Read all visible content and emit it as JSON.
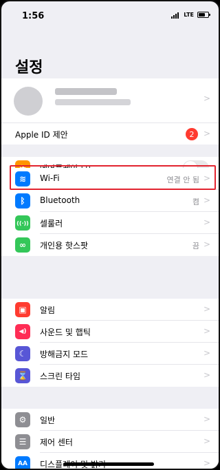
{
  "status_bar": {
    "time": "1:56",
    "network": "LTE"
  },
  "page_title": "설정",
  "apple_id_label": "Apple ID 제안",
  "apple_id_badge": "2",
  "chevron": ">",
  "rows": [
    {
      "id": "airplane",
      "label": "에어플레인 모드",
      "icon_color": "#ff9500",
      "glyph": "✈",
      "value": ""
    },
    {
      "id": "wifi",
      "label": "Wi-Fi",
      "icon_color": "#007aff",
      "glyph": "≋",
      "value": "연결 안 됨"
    },
    {
      "id": "bluetooth",
      "label": "Bluetooth",
      "icon_color": "#007aff",
      "glyph": "ᛒ",
      "value": "켬"
    },
    {
      "id": "cellular",
      "label": "셀룰러",
      "icon_color": "#34c759",
      "glyph": "((·))",
      "value": ""
    },
    {
      "id": "hotspot",
      "label": "개인용 핫스팟",
      "icon_color": "#34c759",
      "glyph": "∞",
      "value": "끔"
    },
    {
      "id": "notifications",
      "label": "알림",
      "icon_color": "#ff3b30",
      "glyph": "▣",
      "value": ""
    },
    {
      "id": "sounds",
      "label": "사운드 및 햅틱",
      "icon_color": "#ff2d55",
      "glyph": "◀)",
      "value": ""
    },
    {
      "id": "do-not-disturb",
      "label": "방해금지 모드",
      "icon_color": "#5856d6",
      "glyph": "☾",
      "value": ""
    },
    {
      "id": "screen-time",
      "label": "스크린 타임",
      "icon_color": "#5856d6",
      "glyph": "⌛",
      "value": ""
    },
    {
      "id": "general",
      "label": "일반",
      "icon_color": "#8e8e93",
      "glyph": "⚙",
      "value": ""
    },
    {
      "id": "control-center",
      "label": "제어 센터",
      "icon_color": "#8e8e93",
      "glyph": "☰",
      "value": ""
    },
    {
      "id": "display",
      "label": "디스플레이 및 밝기",
      "icon_color": "#007aff",
      "glyph": "AA",
      "value": ""
    }
  ]
}
